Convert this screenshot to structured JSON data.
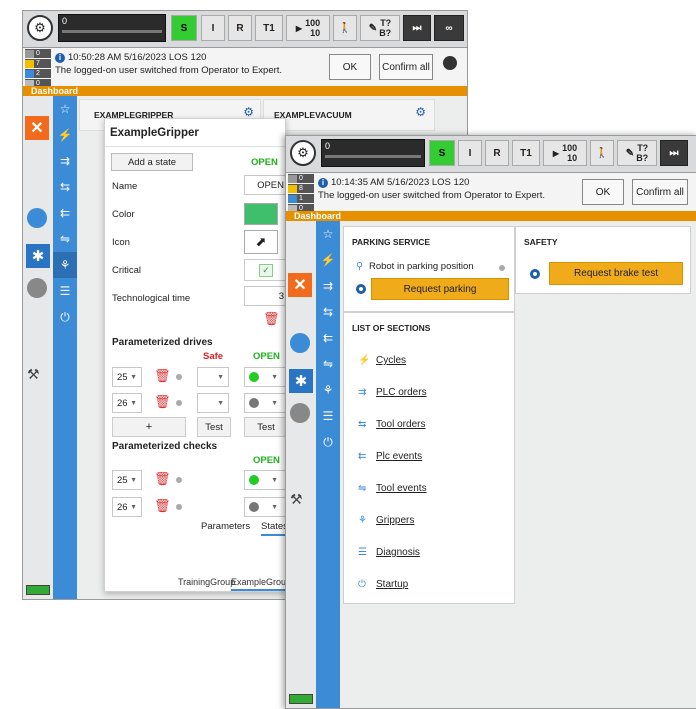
{
  "back_window": {
    "progress_number": "0",
    "mode_buttons": [
      "S",
      "I",
      "R",
      "T1"
    ],
    "override": {
      "top": "100",
      "bottom": "10"
    },
    "status_icons": {
      "teach": "T?",
      "brake": "B?",
      "infinity": "∞"
    },
    "message_counts": [
      "0",
      "7",
      "2",
      "0"
    ],
    "message_time": "10:50:28 AM 5/16/2023 LOS 120",
    "message_text": "The logged-on user switched from Operator to Expert.",
    "ok_label": "OK",
    "confirm_all_label": "Confirm all",
    "dashboard_label": "Dashboard",
    "bg_card_left": "EXAMPLEGRIPPER",
    "bg_card_right": "EXAMPLEVACUUM",
    "tabs_bottom": [
      "TrainingGroup",
      "ExampleGroup"
    ]
  },
  "gripper_panel": {
    "title": "ExampleGripper",
    "add_state_label": "Add a state",
    "state_name_header": "OPEN",
    "fields": {
      "name_label": "Name",
      "name_value": "OPEN",
      "color_label": "Color",
      "icon_label": "Icon",
      "critical_label": "Critical",
      "tech_time_label": "Technological time",
      "tech_time_value": "3"
    },
    "drives_title": "Parameterized drives",
    "safe_label": "Safe",
    "open_label": "OPEN",
    "drives": [
      {
        "value": "25"
      },
      {
        "value": "26"
      }
    ],
    "add_label": "+",
    "test_label": "Test",
    "checks_title": "Parameterized checks",
    "checks": [
      {
        "value": "25"
      },
      {
        "value": "26"
      }
    ],
    "tab_parameters": "Parameters",
    "tab_states": "States"
  },
  "front_window": {
    "progress_number": "0",
    "mode_buttons": [
      "S",
      "I",
      "R",
      "T1"
    ],
    "override": {
      "top": "100",
      "bottom": "10"
    },
    "status_icons": {
      "teach": "T?",
      "brake": "B?"
    },
    "message_counts": [
      "0",
      "8",
      "1",
      "0"
    ],
    "message_time": "10:14:35 AM 5/16/2023 LOS 120",
    "message_text": "The logged-on user switched from Operator to Expert.",
    "ok_label": "OK",
    "confirm_all_label": "Confirm all",
    "dashboard_label": "Dashboard",
    "parking": {
      "title": "PARKING SERVICE",
      "status_text": "Robot in parking position",
      "button_label": "Request parking"
    },
    "safety": {
      "title": "SAFETY",
      "button_label": "Request brake test"
    },
    "sections": {
      "title": "LIST OF SECTIONS",
      "items": [
        "Cycles",
        "PLC orders",
        "Tool orders",
        "Plc events",
        "Tool events",
        "Grippers",
        "Diagnosis",
        "Startup"
      ]
    }
  }
}
